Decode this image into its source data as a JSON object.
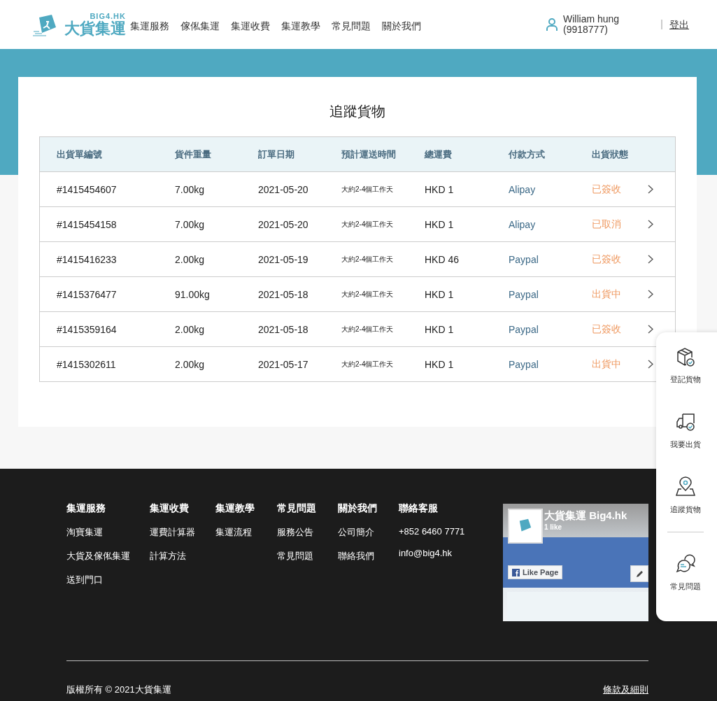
{
  "header": {
    "logo": {
      "top": "BIG4.HK",
      "main": "大貨集運"
    },
    "nav": [
      "集運服務",
      "傢俬集運",
      "集運收費",
      "集運教學",
      "常見問題",
      "關於我們"
    ],
    "user": {
      "name": "William hung",
      "id": "(9918777)"
    },
    "logout": "登出"
  },
  "page": {
    "title": "追蹤貨物"
  },
  "table": {
    "columns": [
      "出貨單編號",
      "貨件重量",
      "訂單日期",
      "預計運送時間",
      "總運費",
      "付款方式",
      "出貨狀態"
    ],
    "rows": [
      {
        "id": "#1415454607",
        "weight": "7.00kg",
        "date": "2021-05-20",
        "eta": "大約2-4個工作天",
        "fee": "HKD 1",
        "payment": "Alipay",
        "status": "已簽收"
      },
      {
        "id": "#1415454158",
        "weight": "7.00kg",
        "date": "2021-05-20",
        "eta": "大約2-4個工作天",
        "fee": "HKD 1",
        "payment": "Alipay",
        "status": "已取消"
      },
      {
        "id": "#1415416233",
        "weight": "2.00kg",
        "date": "2021-05-19",
        "eta": "大約2-4個工作天",
        "fee": "HKD 46",
        "payment": "Paypal",
        "status": "已簽收"
      },
      {
        "id": "#1415376477",
        "weight": "91.00kg",
        "date": "2021-05-18",
        "eta": "大約2-4個工作天",
        "fee": "HKD 1",
        "payment": "Paypal",
        "status": "出貨中"
      },
      {
        "id": "#1415359164",
        "weight": "2.00kg",
        "date": "2021-05-18",
        "eta": "大約2-4個工作天",
        "fee": "HKD 1",
        "payment": "Paypal",
        "status": "已簽收"
      },
      {
        "id": "#1415302611",
        "weight": "2.00kg",
        "date": "2021-05-17",
        "eta": "大約2-4個工作天",
        "fee": "HKD 1",
        "payment": "Paypal",
        "status": "出貨中"
      }
    ]
  },
  "side_panel": [
    {
      "kind": "box",
      "label": "登記貨物"
    },
    {
      "kind": "truck",
      "label": "我要出貨"
    },
    {
      "kind": "pin",
      "label": "追蹤貨物"
    },
    {
      "kind": "chat",
      "label": "常見問題"
    }
  ],
  "footer": {
    "columns": [
      {
        "heading": "集運服務",
        "links": [
          "淘寶集運",
          "大貨及傢俬集運",
          "送到門口"
        ]
      },
      {
        "heading": "集運收費",
        "links": [
          "運費計算器",
          "計算方法"
        ]
      },
      {
        "heading": "集運教學",
        "links": [
          "集運流程"
        ]
      },
      {
        "heading": "常見問題",
        "links": [
          "服務公告",
          "常見問題"
        ]
      },
      {
        "heading": "關於我們",
        "links": [
          "公司簡介",
          "聯絡我們"
        ]
      },
      {
        "heading": "聯絡客服",
        "links": [
          "+852 6460 7771",
          "info@big4.hk"
        ]
      }
    ],
    "facebook": {
      "page_name": "大貨集運 Big4.hk",
      "likes": "1 like",
      "like_button": "Like Page"
    },
    "copyright": "版權所有 © 2021大貨集運",
    "terms": "條款及細則"
  }
}
